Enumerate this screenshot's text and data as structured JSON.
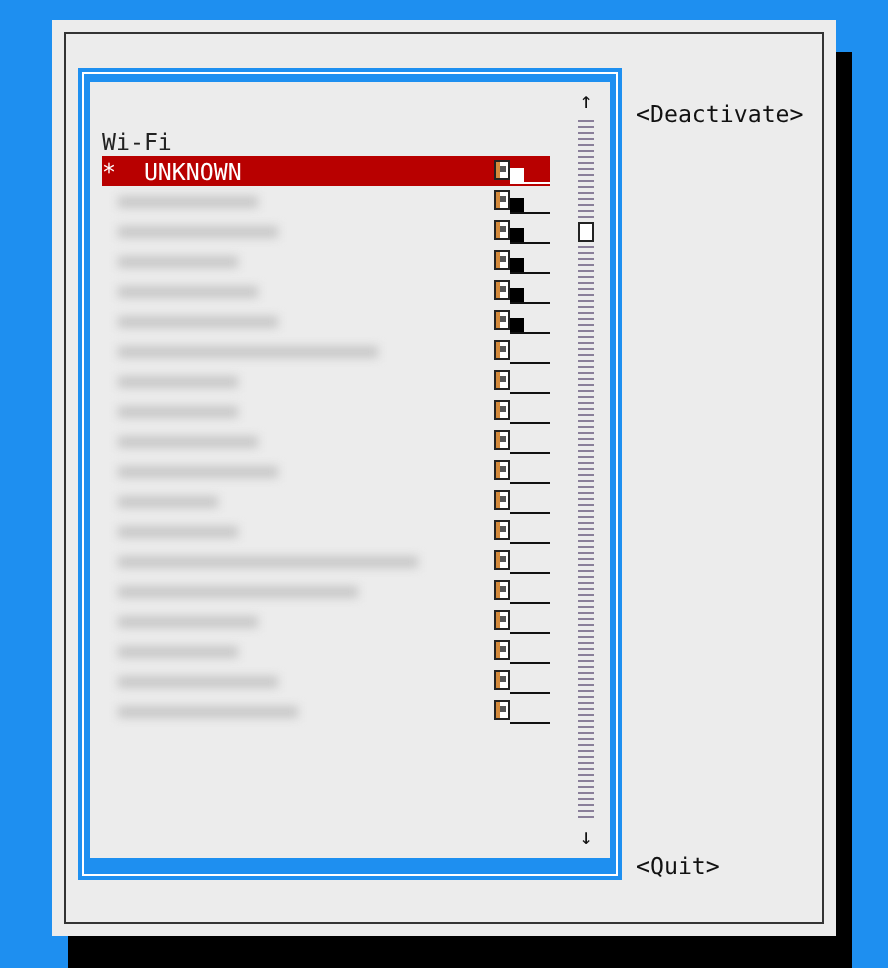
{
  "list": {
    "heading": "Wi-Fi",
    "networks": [
      {
        "kind": "named",
        "marker": "*",
        "name": "UNKNOWN",
        "selected": true,
        "signal_bar": true
      },
      {
        "kind": "blurred",
        "selected": false,
        "signal_bar": true
      },
      {
        "kind": "blurred",
        "selected": false,
        "signal_bar": true
      },
      {
        "kind": "blurred",
        "selected": false,
        "signal_bar": true
      },
      {
        "kind": "blurred",
        "selected": false,
        "signal_bar": true
      },
      {
        "kind": "blurred",
        "selected": false,
        "signal_bar": true
      },
      {
        "kind": "blurred",
        "selected": false,
        "signal_bar": false
      },
      {
        "kind": "blurred",
        "selected": false,
        "signal_bar": false
      },
      {
        "kind": "blurred",
        "selected": false,
        "signal_bar": false
      },
      {
        "kind": "blurred",
        "selected": false,
        "signal_bar": false
      },
      {
        "kind": "blurred",
        "selected": false,
        "signal_bar": false
      },
      {
        "kind": "blurred",
        "selected": false,
        "signal_bar": false
      },
      {
        "kind": "blurred",
        "selected": false,
        "signal_bar": false
      },
      {
        "kind": "blurred",
        "selected": false,
        "signal_bar": false
      },
      {
        "kind": "blurred",
        "selected": false,
        "signal_bar": false
      },
      {
        "kind": "blurred",
        "selected": false,
        "signal_bar": false
      },
      {
        "kind": "blurred",
        "selected": false,
        "signal_bar": false
      },
      {
        "kind": "blurred",
        "selected": false,
        "signal_bar": false
      },
      {
        "kind": "blurred",
        "selected": false,
        "signal_bar": false
      }
    ]
  },
  "scrollbar": {
    "up": "↑",
    "down": "↓"
  },
  "buttons": [
    {
      "label": "<Deactivate>"
    },
    {
      "label": "<Quit>"
    }
  ]
}
